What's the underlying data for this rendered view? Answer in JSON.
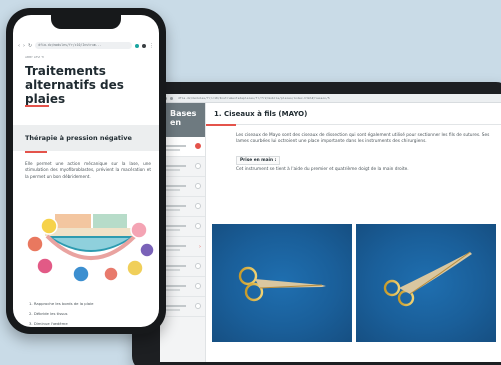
{
  "tablet": {
    "url": "dfia.dz/modules/fr/c10/Instrumentsdeplaies/fr/fr2/mobile/plaies/index.html#/lesson/5",
    "sidebar": {
      "banner_title": "Bases en",
      "item_count": 9,
      "active_index": 0
    },
    "section_title": "1. Ciseaux à fils (MAYO)",
    "paragraph": "Les ciseaux de Mayo sont des ciseaux de dissection qui sont également utilisé pour sectionner les fils de sutures. Ses lames courbées lui octroient une place importante dans les instruments des chirurgiens.",
    "grip_label": "Prise en main :",
    "grip_text": "Cet instrument se tient à l'aide du premier et quatrième doigt de la main droite."
  },
  "phone": {
    "url": "dfia.dz/modules/fr/c10/Instrum...",
    "breadcrumb": "ABBY LEVI TI",
    "title": "Traitements alternatifs des plaies",
    "section_heading": "Thérapie à pression négative",
    "paragraph": "Elle permet une action mécanique sur la lase, une stimulation des myofibroblastes, prévient la macération et la permet un bon débridement.",
    "list": [
      "1. Rapproche les bords de la plaie",
      "2. Débride les tissus",
      "3. Diminue l'œdème"
    ]
  },
  "colors": {
    "accent": "#e4534b",
    "background": "#c9dbe7",
    "device_frame": "#1d1f22",
    "photo_blue": "#1a5f9a"
  },
  "icons": [
    "back-arrow-icon",
    "forward-arrow-icon",
    "reload-icon",
    "profile-icon",
    "menu-icon"
  ]
}
